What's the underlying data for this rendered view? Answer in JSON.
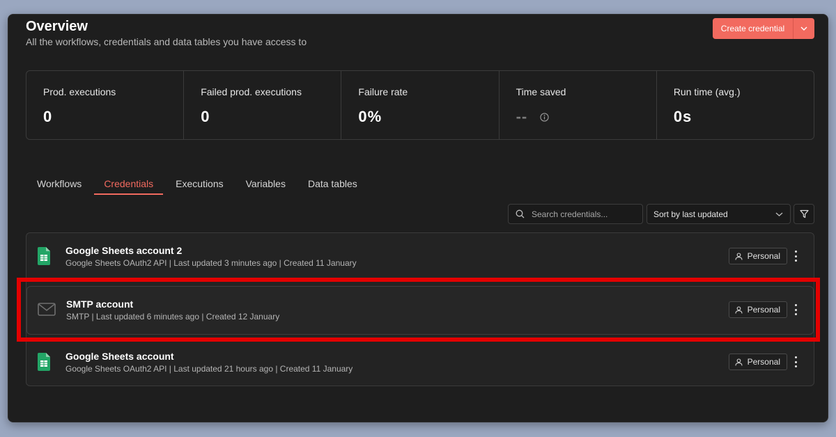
{
  "header": {
    "title": "Overview",
    "subtitle": "All the workflows, credentials and data tables you have access to",
    "create_button": "Create credential"
  },
  "stats": [
    {
      "label": "Prod. executions",
      "value": "0"
    },
    {
      "label": "Failed prod. executions",
      "value": "0"
    },
    {
      "label": "Failure rate",
      "value": "0%"
    },
    {
      "label": "Time saved",
      "value": "--"
    },
    {
      "label": "Run time (avg.)",
      "value": "0s"
    }
  ],
  "tabs": [
    {
      "label": "Workflows"
    },
    {
      "label": "Credentials"
    },
    {
      "label": "Executions"
    },
    {
      "label": "Variables"
    },
    {
      "label": "Data tables"
    }
  ],
  "active_tab": "Credentials",
  "toolbar": {
    "search_placeholder": "Search credentials...",
    "sort_value": "Sort by last updated"
  },
  "credentials": [
    {
      "name": "Google Sheets account 2",
      "meta": "Google Sheets OAuth2 API | Last updated 3 minutes ago | Created 11 January",
      "badge": "Personal",
      "icon": "google-sheets-icon"
    },
    {
      "name": "SMTP account",
      "meta": "SMTP | Last updated 6 minutes ago | Created 12 January",
      "badge": "Personal",
      "icon": "mail-icon"
    },
    {
      "name": "Google Sheets account",
      "meta": "Google Sheets OAuth2 API | Last updated 21 hours ago | Created 11 January",
      "badge": "Personal",
      "icon": "google-sheets-icon"
    }
  ],
  "colors": {
    "accent": "#f26a5f",
    "background": "#1e1e1e",
    "highlight": "#e30000",
    "sheets_green": "#23a566"
  }
}
